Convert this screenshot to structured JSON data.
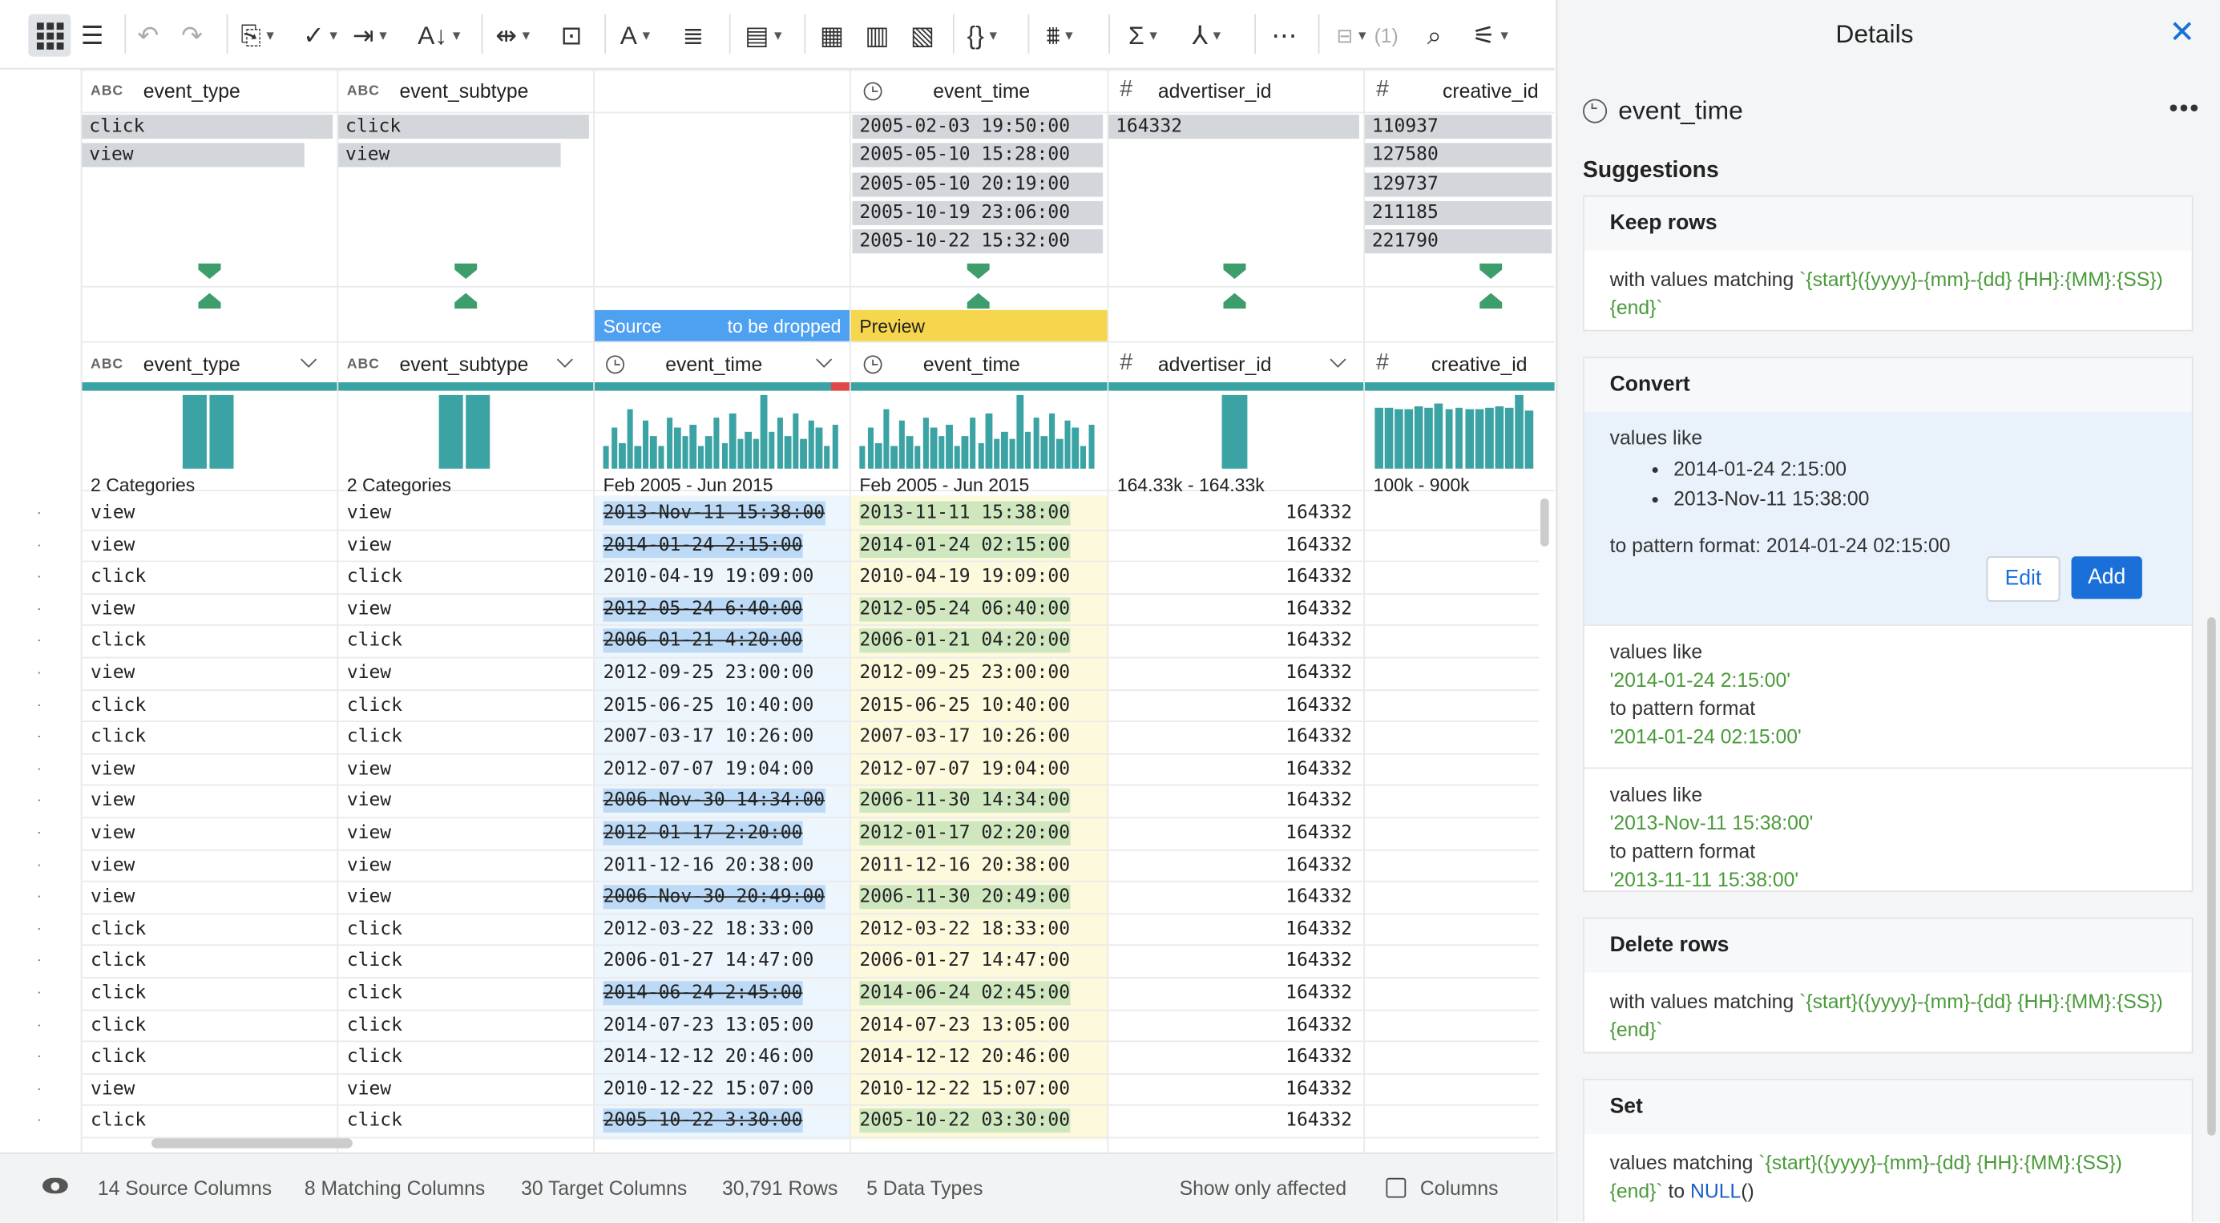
{
  "toolbar": {
    "hidden_count": "(1)"
  },
  "columns_upper": [
    {
      "name": "event_type",
      "type": "ABC",
      "samples": [
        "click",
        "view"
      ]
    },
    {
      "name": "event_subtype",
      "type": "ABC",
      "samples": [
        "click",
        "view"
      ]
    },
    {
      "name": "event_time",
      "type": "time",
      "samples": [
        "2005-02-03 19:50:00",
        "2005-05-10 15:28:00",
        "2005-05-10 20:19:00",
        "2005-10-19 23:06:00",
        "2005-10-22 15:32:00"
      ]
    },
    {
      "name": "advertiser_id",
      "type": "#",
      "samples": [
        "164332"
      ]
    },
    {
      "name": "creative_id",
      "type": "#",
      "samples": [
        "110937",
        "127580",
        "129737",
        "211185",
        "221790"
      ]
    }
  ],
  "bands": {
    "source": "Source",
    "drop": "to be dropped",
    "preview": "Preview"
  },
  "columns_lower": [
    {
      "name": "event_type",
      "type": "ABC",
      "summary": "2 Categories"
    },
    {
      "name": "event_subtype",
      "type": "ABC",
      "summary": "2 Categories"
    },
    {
      "name": "event_time",
      "type": "time",
      "summary": "Feb 2005 - Jun 2015"
    },
    {
      "name": "event_time",
      "type": "time",
      "summary": "Feb 2005 - Jun 2015"
    },
    {
      "name": "advertiser_id",
      "type": "#",
      "summary": "164.33k - 164.33k"
    },
    {
      "name": "creative_id",
      "type": "#",
      "summary": "100k - 900k"
    }
  ],
  "histograms": {
    "event_time": [
      0.3,
      0.55,
      0.35,
      0.8,
      0.3,
      0.65,
      0.45,
      0.3,
      0.7,
      0.55,
      0.45,
      0.6,
      0.3,
      0.45,
      0.7,
      0.35,
      0.75,
      0.4,
      0.5,
      0.4,
      1.0,
      0.5,
      0.7,
      0.45,
      0.75,
      0.4,
      0.65,
      0.55,
      0.3,
      0.6
    ],
    "creative_id": [
      0.82,
      0.82,
      0.8,
      0.8,
      0.85,
      0.82,
      0.88,
      0.8,
      0.82,
      0.8,
      0.8,
      0.82,
      0.85,
      0.82,
      1.0,
      0.78
    ],
    "event_type": [
      1.0,
      1.0
    ],
    "advertiser_id": [
      1.0
    ]
  },
  "rows": [
    {
      "type": "view",
      "subtype": "view",
      "src": "2013-Nov-11 15:38:00",
      "prev": "2013-11-11 15:38:00",
      "adv": "164332",
      "changed": true
    },
    {
      "type": "view",
      "subtype": "view",
      "src": "2014-01-24 2:15:00",
      "prev": "2014-01-24 02:15:00",
      "adv": "164332",
      "changed": true
    },
    {
      "type": "click",
      "subtype": "click",
      "src": "2010-04-19 19:09:00",
      "prev": "2010-04-19 19:09:00",
      "adv": "164332",
      "changed": false
    },
    {
      "type": "view",
      "subtype": "view",
      "src": "2012-05-24 6:40:00",
      "prev": "2012-05-24 06:40:00",
      "adv": "164332",
      "changed": true
    },
    {
      "type": "click",
      "subtype": "click",
      "src": "2006-01-21 4:20:00",
      "prev": "2006-01-21 04:20:00",
      "adv": "164332",
      "changed": true
    },
    {
      "type": "view",
      "subtype": "view",
      "src": "2012-09-25 23:00:00",
      "prev": "2012-09-25 23:00:00",
      "adv": "164332",
      "changed": false
    },
    {
      "type": "click",
      "subtype": "click",
      "src": "2015-06-25 10:40:00",
      "prev": "2015-06-25 10:40:00",
      "adv": "164332",
      "changed": false
    },
    {
      "type": "click",
      "subtype": "click",
      "src": "2007-03-17 10:26:00",
      "prev": "2007-03-17 10:26:00",
      "adv": "164332",
      "changed": false
    },
    {
      "type": "view",
      "subtype": "view",
      "src": "2012-07-07 19:04:00",
      "prev": "2012-07-07 19:04:00",
      "adv": "164332",
      "changed": false
    },
    {
      "type": "view",
      "subtype": "view",
      "src": "2006-Nov-30 14:34:00",
      "prev": "2006-11-30 14:34:00",
      "adv": "164332",
      "changed": true
    },
    {
      "type": "view",
      "subtype": "view",
      "src": "2012-01-17 2:20:00",
      "prev": "2012-01-17 02:20:00",
      "adv": "164332",
      "changed": true
    },
    {
      "type": "view",
      "subtype": "view",
      "src": "2011-12-16 20:38:00",
      "prev": "2011-12-16 20:38:00",
      "adv": "164332",
      "changed": false
    },
    {
      "type": "view",
      "subtype": "view",
      "src": "2006-Nov-30 20:49:00",
      "prev": "2006-11-30 20:49:00",
      "adv": "164332",
      "changed": true
    },
    {
      "type": "click",
      "subtype": "click",
      "src": "2012-03-22 18:33:00",
      "prev": "2012-03-22 18:33:00",
      "adv": "164332",
      "changed": false
    },
    {
      "type": "click",
      "subtype": "click",
      "src": "2006-01-27 14:47:00",
      "prev": "2006-01-27 14:47:00",
      "adv": "164332",
      "changed": false
    },
    {
      "type": "click",
      "subtype": "click",
      "src": "2014-06-24 2:45:00",
      "prev": "2014-06-24 02:45:00",
      "adv": "164332",
      "changed": true
    },
    {
      "type": "click",
      "subtype": "click",
      "src": "2014-07-23 13:05:00",
      "prev": "2014-07-23 13:05:00",
      "adv": "164332",
      "changed": false
    },
    {
      "type": "click",
      "subtype": "click",
      "src": "2014-12-12 20:46:00",
      "prev": "2014-12-12 20:46:00",
      "adv": "164332",
      "changed": false
    },
    {
      "type": "view",
      "subtype": "view",
      "src": "2010-12-22 15:07:00",
      "prev": "2010-12-22 15:07:00",
      "adv": "164332",
      "changed": false
    },
    {
      "type": "click",
      "subtype": "click",
      "src": "2005-10-22 3:30:00",
      "prev": "2005-10-22 03:30:00",
      "adv": "164332",
      "changed": true
    }
  ],
  "status": {
    "source_columns": "14 Source Columns",
    "matching_columns": "8 Matching Columns",
    "target_columns": "30 Target Columns",
    "rows": "30,791 Rows",
    "data_types": "5 Data Types",
    "show_only_affected": "Show only affected",
    "columns": "Columns"
  },
  "panel": {
    "title": "Details",
    "field": "event_time",
    "suggestions": "Suggestions",
    "keep_rows": {
      "title": "Keep rows",
      "prefix": "with values matching ",
      "pattern": "`{start}({yyyy}-{mm}-{dd} {HH}:{MM}:{SS}){end}`"
    },
    "convert": {
      "title": "Convert",
      "values_like": "values like",
      "examples": [
        "2014-01-24 2:15:00",
        "2013-Nov-11 15:38:00"
      ],
      "to_pattern": "to pattern format: 2014-01-24 02:15:00",
      "edit": "Edit",
      "add": "Add"
    },
    "convert_alt1": {
      "values_like": "values like",
      "value": "'2014-01-24 2:15:00'",
      "to_pattern": "to pattern format",
      "pattern": "'2014-01-24 02:15:00'"
    },
    "convert_alt2": {
      "values_like": "values like",
      "value": "'2013-Nov-11 15:38:00'",
      "to_pattern": "to pattern format",
      "pattern": "'2013-11-11 15:38:00'"
    },
    "delete_rows": {
      "title": "Delete rows",
      "prefix": "with values matching ",
      "pattern": "`{start}({yyyy}-{mm}-{dd} {HH}:{MM}:{SS}){end}`"
    },
    "set": {
      "title": "Set",
      "prefix": "values matching ",
      "pattern": "`{start}({yyyy}-{mm}-{dd} {HH}:{MM}:{SS}){end}`",
      "to": " to ",
      "null_fn": "NULL",
      "parens": "()"
    }
  },
  "colors": {
    "accent": "#1a6fd8",
    "teal": "#3ba3a3",
    "source_band": "#4ea0f0",
    "preview_band": "#f6d64c",
    "match_green": "#4a9a3a"
  }
}
